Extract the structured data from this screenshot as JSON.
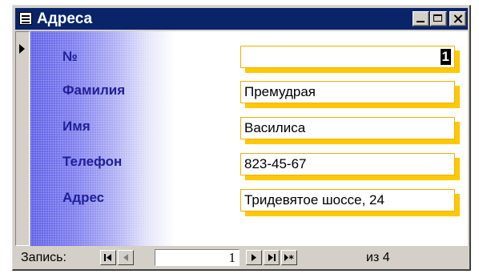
{
  "window": {
    "title": "Адреса",
    "icon": "form-icon"
  },
  "fields": [
    {
      "label": "№",
      "value": "1"
    },
    {
      "label": "Фамилия",
      "value": "Премудрая"
    },
    {
      "label": "Имя",
      "value": "Василиса"
    },
    {
      "label": "Телефон",
      "value": "823-45-67"
    },
    {
      "label": "Адрес",
      "value": "Тридевятое шоссе, 24"
    }
  ],
  "navigation": {
    "label": "Запись:",
    "current": "1",
    "of_label": "из 4",
    "buttons": [
      "first-record-icon",
      "prev-record-icon",
      "next-record-icon",
      "last-record-icon",
      "new-record-icon"
    ]
  },
  "colors": {
    "titlebar": "#0a246a",
    "label": "#20209a",
    "field_shadow": "#ffc800"
  }
}
